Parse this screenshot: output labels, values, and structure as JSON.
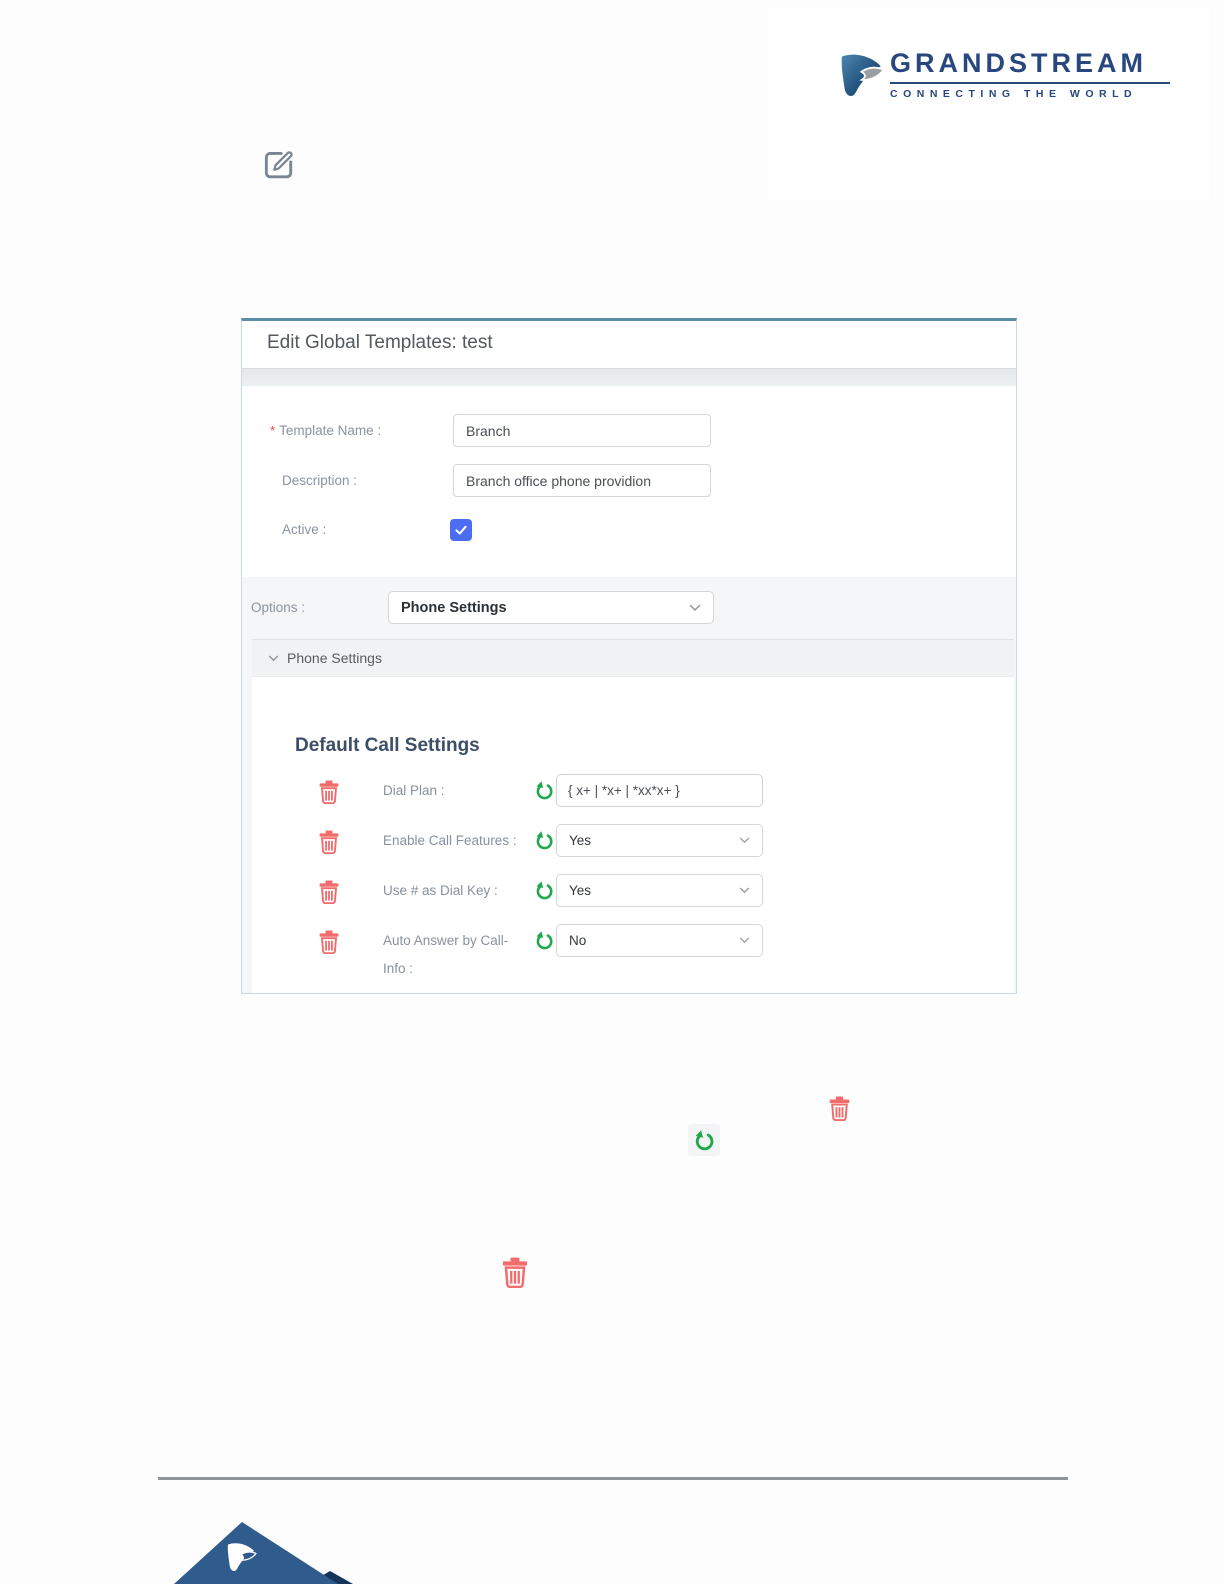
{
  "logo": {
    "brand": "GRANDSTREAM",
    "tagline": "CONNECTING THE WORLD"
  },
  "dialog": {
    "title": "Edit Global Templates: test",
    "form": {
      "template_name": {
        "required_mark": "*",
        "label": "Template Name :",
        "value": "Branch"
      },
      "description": {
        "label": "Description :",
        "value": "Branch office phone providion"
      },
      "active": {
        "label": "Active :",
        "checked": true
      }
    },
    "options": {
      "label": "Options :",
      "value": "Phone Settings"
    },
    "collapse": {
      "header": "Phone Settings"
    },
    "call_settings": {
      "heading": "Default Call Settings",
      "rows": [
        {
          "label": "Dial Plan :",
          "control": "input",
          "value": "{ x+ | *x+ | *xx*x+ }"
        },
        {
          "label": "Enable Call Features :",
          "control": "select",
          "value": "Yes"
        },
        {
          "label": "Use # as Dial Key :",
          "control": "select",
          "value": "Yes"
        },
        {
          "label": "Auto Answer by Call-",
          "label_line2": "Info :",
          "control": "select",
          "value": "No"
        }
      ]
    }
  },
  "icons": {
    "edit-icon": "pencil-in-square",
    "trash-icon": "trash-can",
    "reset-icon": "circular-undo-arrow",
    "chevron-down-icon": "chevron-down",
    "check-icon": "checkmark",
    "grandstream-mark-icon": "blue-plectrum-with-gray-swoosh",
    "grandstream-pyramid-icon": "blue-pyramid-with-white-mark"
  },
  "colors": {
    "accent_blue": "#4b6cf3",
    "danger_red": "#f26c6c",
    "success_green": "#1ea84b",
    "dialog_top_border": "#5c8ba6",
    "brand_navy": "#27477e",
    "pyramid_blue": "#305b8d"
  }
}
